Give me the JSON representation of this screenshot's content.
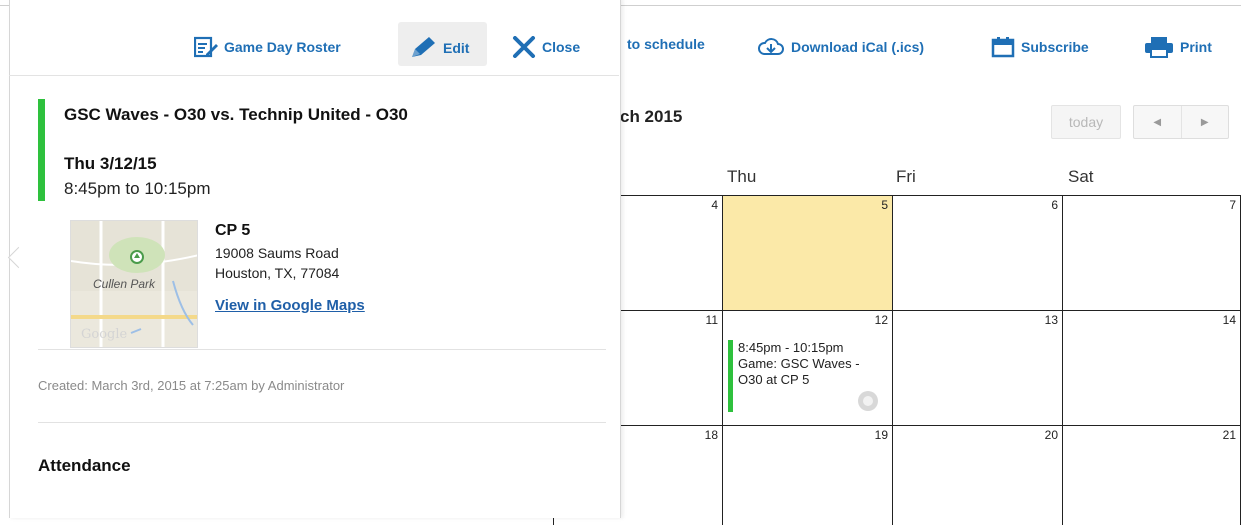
{
  "toolbar": {
    "game_day_roster": "Game Day Roster",
    "edit": "Edit",
    "close": "Close",
    "to_schedule": "to schedule",
    "download_ical": "Download iCal (.ics)",
    "subscribe": "Subscribe",
    "print": "Print"
  },
  "calendar": {
    "month_title_visible": "ch 2015",
    "today_label": "today",
    "prev_label": "◀",
    "next_label": "▶",
    "days_of_week": [
      "Thu",
      "Fri",
      "Sat"
    ],
    "weeks": [
      [
        "4",
        "5",
        "6",
        "7"
      ],
      [
        "11",
        "12",
        "13",
        "14"
      ],
      [
        "18",
        "19",
        "20",
        "21"
      ]
    ],
    "today_day": "5",
    "event": {
      "time": "8:45pm - 10:15pm",
      "title": "Game: GSC Waves - O30 at CP 5"
    }
  },
  "popover": {
    "title": "GSC Waves - O30 vs. Technip United - O30",
    "date": "Thu 3/12/15",
    "time": "8:45pm to 10:15pm",
    "location": {
      "name": "CP 5",
      "address_line1": "19008 Saums Road",
      "address_line2": "Houston, TX, 77084",
      "map_link": "View in Google Maps",
      "map_label": "Cullen Park",
      "map_brand": "Google"
    },
    "created": "Created: March 3rd, 2015 at 7:25am by Administrator",
    "attendance_heading": "Attendance"
  },
  "colors": {
    "accent_blue": "#1f6fb5",
    "event_green": "#2ec13d",
    "today_yellow": "#fbe9a8"
  }
}
